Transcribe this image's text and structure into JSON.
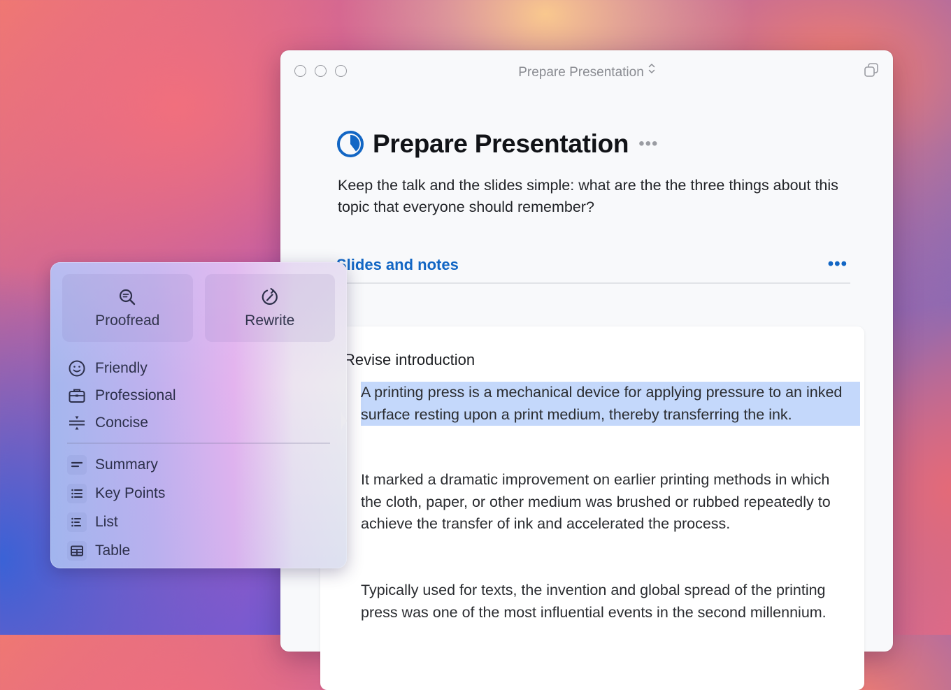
{
  "window": {
    "title": "Prepare Presentation",
    "title_chevron": "⌃⌄",
    "copy_icon": "copy-window-icon"
  },
  "page": {
    "title": "Prepare Presentation",
    "more_label": "•••",
    "description": "Keep the talk and the slides simple: what are the the three things about this topic that everyone should remember?",
    "status_icon": "progress-ring-icon",
    "accent_color": "#1266c4"
  },
  "section": {
    "title": "Slides and notes",
    "more_label": "•••"
  },
  "task": {
    "title": "Revise introduction",
    "paragraphs": [
      "A printing press is a mechanical device for applying pressure to an inked surface resting upon a print medium, thereby transferring the ink.",
      "It marked a dramatic improvement on earlier printing methods in which the cloth, paper, or other medium was brushed or rubbed repeatedly to achieve the transfer of ink and accelerated the process.",
      "Typically used for texts, the invention and global spread of the printing press was one of the most influential events in the second millennium."
    ],
    "highlight_color": "#c4d8fb"
  },
  "writing_tools": {
    "primary": [
      {
        "label": "Proofread",
        "icon": "proofread-magnifier-icon"
      },
      {
        "label": "Rewrite",
        "icon": "rewrite-cycle-icon"
      }
    ],
    "tones": [
      {
        "label": "Friendly",
        "icon": "smiley-icon"
      },
      {
        "label": "Professional",
        "icon": "briefcase-icon"
      },
      {
        "label": "Concise",
        "icon": "compress-icon"
      }
    ],
    "formats": [
      {
        "label": "Summary",
        "icon": "summary-lines-icon"
      },
      {
        "label": "Key Points",
        "icon": "bullet-list-icon"
      },
      {
        "label": "List",
        "icon": "list-icon"
      },
      {
        "label": "Table",
        "icon": "table-icon"
      }
    ]
  }
}
